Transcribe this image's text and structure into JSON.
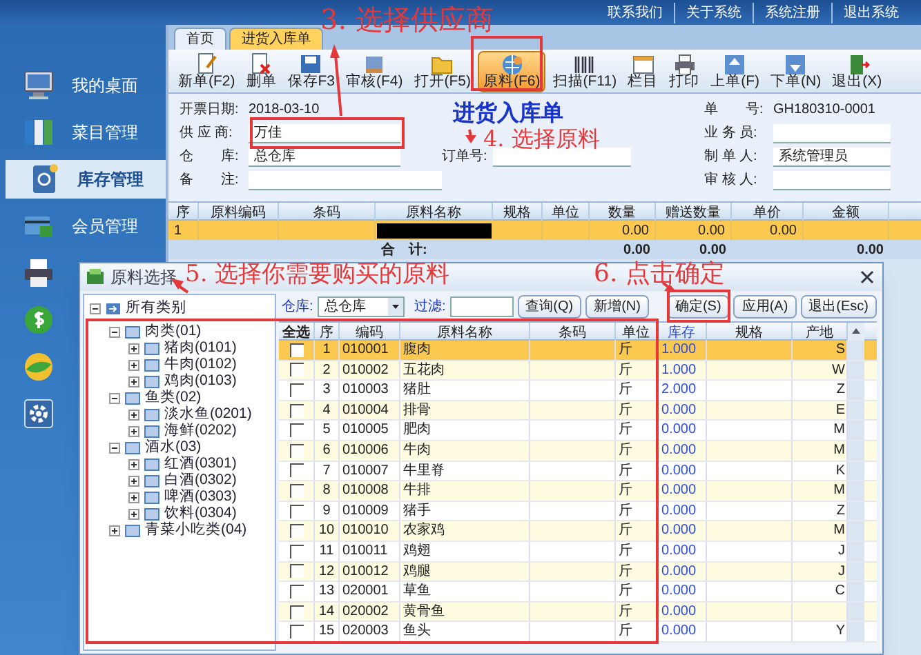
{
  "top_links": [
    "联系我们",
    "关于系统",
    "系统注册",
    "退出系统"
  ],
  "sidebar": {
    "items": [
      {
        "label": "我的桌面",
        "selected": false
      },
      {
        "label": "菜目管理",
        "selected": false
      },
      {
        "label": "库存管理",
        "selected": true
      },
      {
        "label": "会员管理",
        "selected": false
      },
      {
        "selected": false
      },
      {
        "selected": false
      },
      {
        "selected": false
      },
      {
        "selected": false
      }
    ]
  },
  "tabs": [
    {
      "label": "首页",
      "selected": false
    },
    {
      "label": "进货入库单",
      "selected": true
    }
  ],
  "toolbar": [
    {
      "label": "新单(F2)",
      "selected": false
    },
    {
      "label": "删单",
      "selected": false
    },
    {
      "label": "保存F3",
      "selected": false
    },
    {
      "label": "审核(F4)",
      "selected": false
    },
    {
      "label": "打开(F5)",
      "selected": false
    },
    {
      "label": "原料(F6)",
      "selected": true
    },
    {
      "label": "扫描(F11)",
      "selected": false
    },
    {
      "label": "栏目",
      "selected": false
    },
    {
      "label": "打印",
      "selected": false
    },
    {
      "label": "上单(F)",
      "selected": false
    },
    {
      "label": "下单(N)",
      "selected": false
    },
    {
      "label": "退出(X)",
      "selected": false
    }
  ],
  "form": {
    "title": "进货入库单",
    "left": [
      {
        "label": "开票日期:",
        "value": "2018-03-10",
        "kind": "text"
      },
      {
        "label": "供 应 商:",
        "value": "万佳",
        "kind": "field"
      },
      {
        "label": "仓　　库:",
        "value": "总仓库",
        "kind": "field"
      },
      {
        "label": "备　　注:",
        "kind": "field"
      }
    ],
    "order_no": {
      "label": "订单号:"
    },
    "right": [
      {
        "label": "单　　号:",
        "value": "GH180310-0001",
        "kind": "text"
      },
      {
        "label": "业 务 员:",
        "kind": "field"
      },
      {
        "label": "制 单 人:",
        "value": "系统管理员",
        "kind": "field"
      },
      {
        "label": "审 核 人:",
        "kind": "field"
      }
    ]
  },
  "grid": {
    "columns": [
      "序",
      "原料编码",
      "条码",
      "原料名称",
      "规格",
      "单位",
      "数量",
      "赠送数量",
      "单价",
      "金额"
    ],
    "rows": [
      {
        "cells": [
          "1",
          "",
          "",
          "",
          "",
          "",
          "0.00",
          "0.00",
          "0.00",
          ""
        ],
        "selected": true
      }
    ],
    "totals": {
      "label": "合　计:",
      "cells": [
        "0.00",
        "0.00",
        "",
        "0.00"
      ]
    }
  },
  "dialog": {
    "title": "原料选择",
    "tree": [
      {
        "label": "所有类别",
        "expanded": true,
        "children": [
          {
            "label": "肉类(01)",
            "expanded": true,
            "children": [
              {
                "label": "猪肉(0101)",
                "expanded": false
              },
              {
                "label": "牛肉(0102)",
                "expanded": false
              },
              {
                "label": "鸡肉(0103)",
                "expanded": false
              }
            ]
          },
          {
            "label": "鱼类(02)",
            "expanded": true,
            "children": [
              {
                "label": "淡水鱼(0201)",
                "expanded": false
              },
              {
                "label": "海鲜(0202)",
                "expanded": false
              }
            ]
          },
          {
            "label": "酒水(03)",
            "expanded": true,
            "children": [
              {
                "label": "红酒(0301)",
                "expanded": false
              },
              {
                "label": "白酒(0302)",
                "expanded": false
              },
              {
                "label": "啤酒(0303)",
                "expanded": false
              },
              {
                "label": "饮料(0304)",
                "expanded": false
              }
            ]
          },
          {
            "label": "青菜小吃类(04)",
            "expanded": false
          }
        ]
      }
    ],
    "warehouse": {
      "label": "仓库:",
      "value": "总仓库"
    },
    "filter": {
      "label": "过滤:"
    },
    "buttons": [
      "查询(Q)",
      "新增(N)",
      "确定(S)",
      "应用(A)",
      "退出(Esc)"
    ],
    "columns": [
      "全选",
      "序",
      "编码",
      "原料名称",
      "条码",
      "单位",
      "库存",
      "规格",
      "产地"
    ],
    "rows": [
      {
        "checked": false,
        "selected": true,
        "cells": [
          "",
          "1",
          "010001",
          "腹肉",
          "",
          "斤",
          "1.000",
          "",
          "S"
        ]
      },
      {
        "checked": false,
        "selected": false,
        "cells": [
          "",
          "2",
          "010002",
          "五花肉",
          "",
          "斤",
          "1.000",
          "",
          "W"
        ]
      },
      {
        "checked": false,
        "selected": false,
        "cells": [
          "",
          "3",
          "010003",
          "猪肚",
          "",
          "斤",
          "2.000",
          "",
          "Z"
        ]
      },
      {
        "checked": false,
        "selected": false,
        "cells": [
          "",
          "4",
          "010004",
          "排骨",
          "",
          "斤",
          "0.000",
          "",
          "E"
        ]
      },
      {
        "checked": false,
        "selected": false,
        "cells": [
          "",
          "5",
          "010005",
          "肥肉",
          "",
          "斤",
          "0.000",
          "",
          "M"
        ]
      },
      {
        "checked": false,
        "selected": false,
        "cells": [
          "",
          "6",
          "010006",
          "牛肉",
          "",
          "斤",
          "0.000",
          "",
          "M"
        ]
      },
      {
        "checked": false,
        "selected": false,
        "cells": [
          "",
          "7",
          "010007",
          "牛里脊",
          "",
          "斤",
          "0.000",
          "",
          "K"
        ]
      },
      {
        "checked": false,
        "selected": false,
        "cells": [
          "",
          "8",
          "010008",
          "牛排",
          "",
          "斤",
          "0.000",
          "",
          "M"
        ]
      },
      {
        "checked": false,
        "selected": false,
        "cells": [
          "",
          "9",
          "010009",
          "猪手",
          "",
          "斤",
          "0.000",
          "",
          "Z"
        ]
      },
      {
        "checked": false,
        "selected": false,
        "cells": [
          "",
          "10",
          "010010",
          "农家鸡",
          "",
          "斤",
          "0.000",
          "",
          "M"
        ]
      },
      {
        "checked": false,
        "selected": false,
        "cells": [
          "",
          "11",
          "010011",
          "鸡翅",
          "",
          "斤",
          "0.000",
          "",
          "J"
        ]
      },
      {
        "checked": false,
        "selected": false,
        "cells": [
          "",
          "12",
          "010012",
          "鸡腿",
          "",
          "斤",
          "0.000",
          "",
          "J"
        ]
      },
      {
        "checked": false,
        "selected": false,
        "cells": [
          "",
          "13",
          "020001",
          "草鱼",
          "",
          "斤",
          "0.000",
          "",
          "C"
        ]
      },
      {
        "checked": false,
        "selected": false,
        "cells": [
          "",
          "14",
          "020002",
          "黄骨鱼",
          "",
          "斤",
          "0.000",
          "",
          ""
        ]
      },
      {
        "checked": false,
        "selected": false,
        "cells": [
          "",
          "15",
          "020003",
          "鱼头",
          "",
          "斤",
          "0.000",
          "",
          "Y"
        ]
      }
    ]
  },
  "annotations": [
    "3. 选择供应商",
    "4. 选择原料",
    "5. 选择你需要购买的原料",
    "6. 点击确定"
  ]
}
